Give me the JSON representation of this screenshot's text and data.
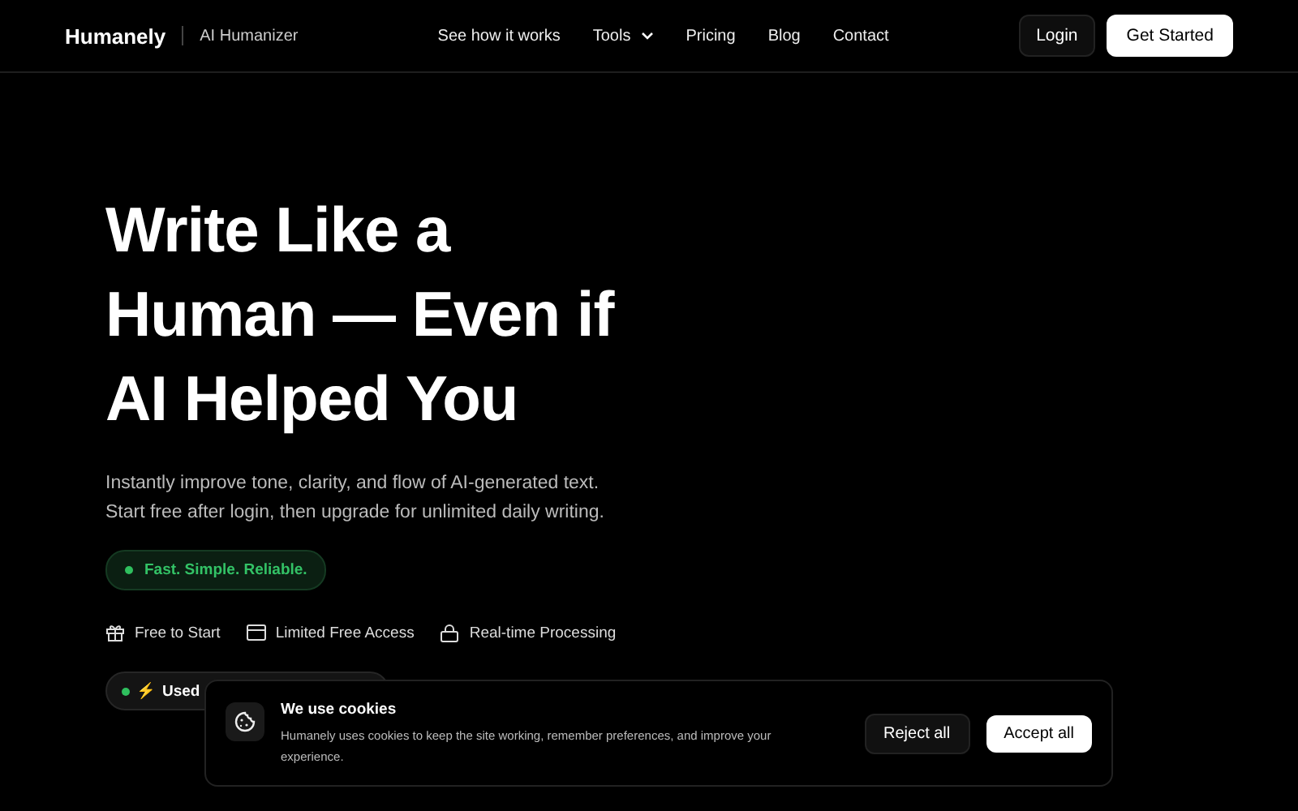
{
  "nav": {
    "brand": "Humanely",
    "product": "AI Humanizer",
    "links": [
      {
        "label": "See how it works",
        "dropdown": false
      },
      {
        "label": "Tools",
        "dropdown": true
      },
      {
        "label": "Pricing",
        "dropdown": false
      },
      {
        "label": "Blog",
        "dropdown": false
      },
      {
        "label": "Contact",
        "dropdown": false
      }
    ],
    "login": "Login",
    "cta": "Get Started"
  },
  "hero": {
    "title_lines": [
      "Write Like a",
      "Human — Even if",
      "AI Helped You"
    ],
    "subtitle_lines": [
      "Instantly improve tone, clarity, and flow of AI-generated text.",
      "Start free after login, then upgrade for unlimited daily writing."
    ],
    "badge": "Fast. Simple. Reliable.",
    "features": [
      {
        "kind": "gift",
        "label": "Free to Start"
      },
      {
        "kind": "card",
        "label": "Limited Free Access"
      },
      {
        "kind": "lock",
        "label": "Real-time Processing"
      }
    ],
    "usage_pill": {
      "icon": "⚡",
      "text": "Used"
    }
  },
  "cookie_banner": {
    "title": "We use cookies",
    "text": "Humanely uses cookies to keep the site working, remember preferences, and improve your experience.",
    "reject": "Reject all",
    "accept": "Accept all"
  }
}
